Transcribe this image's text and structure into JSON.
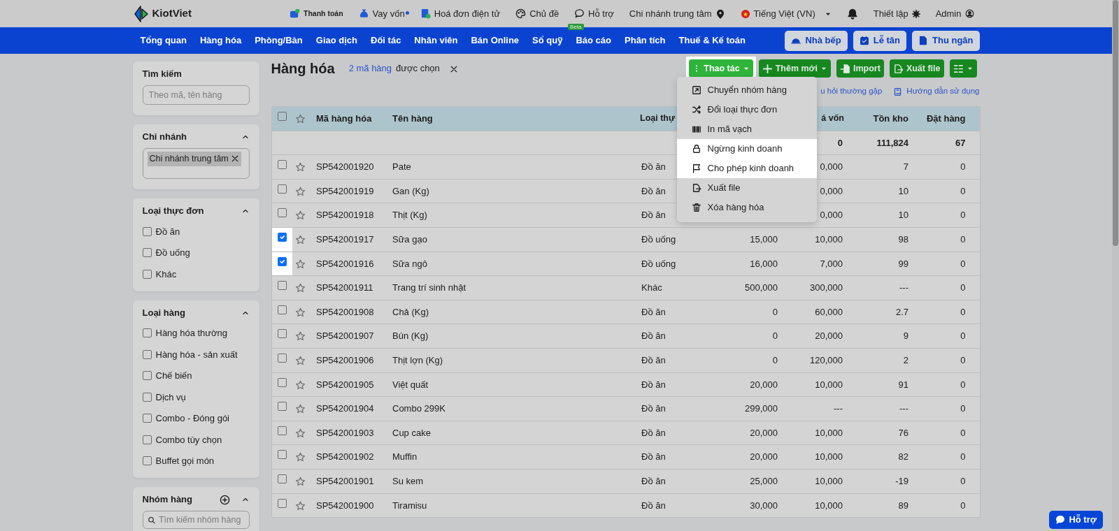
{
  "topbar": {
    "logo": "KiotViet",
    "links": [
      {
        "label": "Thanh toán",
        "kind": "compact",
        "notification": false
      },
      {
        "label": "Vay vốn",
        "kind": "normal",
        "notification": true
      },
      {
        "label": "Hoá đơn điện tử",
        "kind": "normal",
        "notification": false
      },
      {
        "label": "Chủ đề",
        "kind": "normal",
        "notification": false
      },
      {
        "label": "Hỗ trợ",
        "kind": "normal",
        "notification": false,
        "tag": "Beta"
      }
    ],
    "branch": "Chi nhánh trung tâm",
    "language": "Tiếng Việt (VN)",
    "settings": "Thiết lập",
    "user": "Admin"
  },
  "nav": {
    "items": [
      "Tổng quan",
      "Hàng hóa",
      "Phòng/Bàn",
      "Giao dịch",
      "Đối tác",
      "Nhân viên",
      "Bán Online",
      "Sổ quỹ",
      "Báo cáo",
      "Phân tích",
      "Thuế & Kế toán"
    ],
    "actions": [
      "Nhà bếp",
      "Lễ tân",
      "Thu ngân"
    ]
  },
  "sidebar": {
    "panels": [
      {
        "kind": "search",
        "title": "Tìm kiếm",
        "placeholder": "Theo mã, tên hàng"
      },
      {
        "kind": "tags",
        "title": "Chi nhánh",
        "expanded": true,
        "tags": [
          "Chi nhánh trung tâm"
        ]
      },
      {
        "kind": "checklist",
        "title": "Loại thực đơn",
        "expanded": true,
        "options": [
          {
            "label": "Đồ ăn",
            "checked": false
          },
          {
            "label": "Đồ uống",
            "checked": false
          },
          {
            "label": "Khác",
            "checked": false
          }
        ]
      },
      {
        "kind": "checklist",
        "title": "Loại hàng",
        "expanded": true,
        "options": [
          {
            "label": "Hàng hóa thường",
            "checked": false
          },
          {
            "label": "Hàng hóa - sản xuất",
            "checked": false
          },
          {
            "label": "Chế biến",
            "checked": false
          },
          {
            "label": "Dịch vụ",
            "checked": false
          },
          {
            "label": "Combo - Đóng gói",
            "checked": false
          },
          {
            "label": "Combo tùy chọn",
            "checked": false
          },
          {
            "label": "Buffet gọi món",
            "checked": false
          }
        ]
      },
      {
        "kind": "group",
        "title": "Nhóm hàng",
        "expanded": true,
        "placeholder": "Tìm kiếm nhóm hàng"
      }
    ]
  },
  "page": {
    "title": "Hàng hóa",
    "selection": {
      "count": "2 mã hàng",
      "suffix": "được chọn"
    }
  },
  "toolbar": {
    "buttons": [
      {
        "label": "Thao tác",
        "highlighted": true
      },
      {
        "label": "Thêm mới",
        "highlighted": false
      },
      {
        "label": "Import",
        "highlighted": false
      },
      {
        "label": "Xuất file",
        "highlighted": false
      },
      {
        "highlighted": false
      }
    ],
    "links": [
      "u hỏi thường gặp",
      "Hướng dẫn sử dụng"
    ]
  },
  "action_menu": {
    "items": [
      {
        "label": "Chuyển nhóm hàng",
        "highlighted": false
      },
      {
        "label": "Đổi loại thực đơn",
        "highlighted": false
      },
      {
        "label": "In mã vạch",
        "highlighted": false
      },
      {
        "label": "Ngừng kinh doanh",
        "highlighted": true
      },
      {
        "label": "Cho phép kinh doanh",
        "highlighted": true
      },
      {
        "label": "Xuất file",
        "highlighted": false
      },
      {
        "label": "Xóa hàng hóa",
        "highlighted": false
      }
    ]
  },
  "table": {
    "select_all_checked": false,
    "columns": {
      "code": "Mã hàng hóa",
      "name": "Tên hàng",
      "type": "Loại thự",
      "cost": "á vốn",
      "stock": "Tồn kho",
      "ordered": "Đặt hàng"
    },
    "summary": {
      "cost": "0",
      "stock": "111,824",
      "ordered": "67"
    },
    "rows": [
      {
        "code": "SP542001920",
        "name": "Pate",
        "type": "Đồ ăn",
        "cost": "0,000",
        "stock": "7",
        "ordered": "0",
        "checked": false
      },
      {
        "code": "SP542001919",
        "name": "Gan (Kg)",
        "type": "Đồ ăn",
        "cost": "0,000",
        "stock": "10",
        "ordered": "0",
        "checked": false
      },
      {
        "code": "SP542001918",
        "name": "Thịt (Kg)",
        "type": "Đồ ăn",
        "cost": "0,000",
        "stock": "10",
        "ordered": "0",
        "checked": false
      },
      {
        "code": "SP542001917",
        "name": "Sữa gạo",
        "type": "Đồ uống",
        "price": "15,000",
        "cost": "10,000",
        "stock": "98",
        "ordered": "0",
        "checked": true
      },
      {
        "code": "SP542001916",
        "name": "Sữa ngô",
        "type": "Đồ uống",
        "price": "16,000",
        "cost": "7,000",
        "stock": "99",
        "ordered": "0",
        "checked": true
      },
      {
        "code": "SP542001911",
        "name": "Trang trí sinh nhật",
        "type": "Khác",
        "price": "500,000",
        "cost": "300,000",
        "stock": "---",
        "ordered": "0",
        "checked": false
      },
      {
        "code": "SP542001908",
        "name": "Chả (Kg)",
        "type": "Đồ ăn",
        "price": "0",
        "cost": "60,000",
        "stock": "2.7",
        "ordered": "0",
        "checked": false
      },
      {
        "code": "SP542001907",
        "name": "Bún (Kg)",
        "type": "Đồ ăn",
        "price": "0",
        "cost": "20,000",
        "stock": "9",
        "ordered": "0",
        "checked": false
      },
      {
        "code": "SP542001906",
        "name": "Thịt lợn (Kg)",
        "type": "Đồ ăn",
        "price": "0",
        "cost": "120,000",
        "stock": "2",
        "ordered": "0",
        "checked": false
      },
      {
        "code": "SP542001905",
        "name": "Việt quất",
        "type": "Đồ ăn",
        "price": "20,000",
        "cost": "10,000",
        "stock": "91",
        "ordered": "0",
        "checked": false
      },
      {
        "code": "SP542001904",
        "name": "Combo 299K",
        "type": "Đồ ăn",
        "price": "299,000",
        "cost": "---",
        "stock": "---",
        "ordered": "0",
        "checked": false
      },
      {
        "code": "SP542001903",
        "name": "Cup cake",
        "type": "Đồ ăn",
        "price": "20,000",
        "cost": "10,000",
        "stock": "76",
        "ordered": "0",
        "checked": false
      },
      {
        "code": "SP542001902",
        "name": "Muffin",
        "type": "Đồ ăn",
        "price": "20,000",
        "cost": "10,000",
        "stock": "82",
        "ordered": "0",
        "checked": false
      },
      {
        "code": "SP542001901",
        "name": "Su kem",
        "type": "Đồ ăn",
        "price": "25,000",
        "cost": "10,000",
        "stock": "-19",
        "ordered": "0",
        "checked": false
      },
      {
        "code": "SP542001900",
        "name": "Tiramisu",
        "type": "Đồ ăn",
        "price": "30,000",
        "cost": "10,000",
        "stock": "89",
        "ordered": "0",
        "checked": false
      }
    ]
  },
  "support_button": {
    "label": "Hỗ trợ"
  }
}
